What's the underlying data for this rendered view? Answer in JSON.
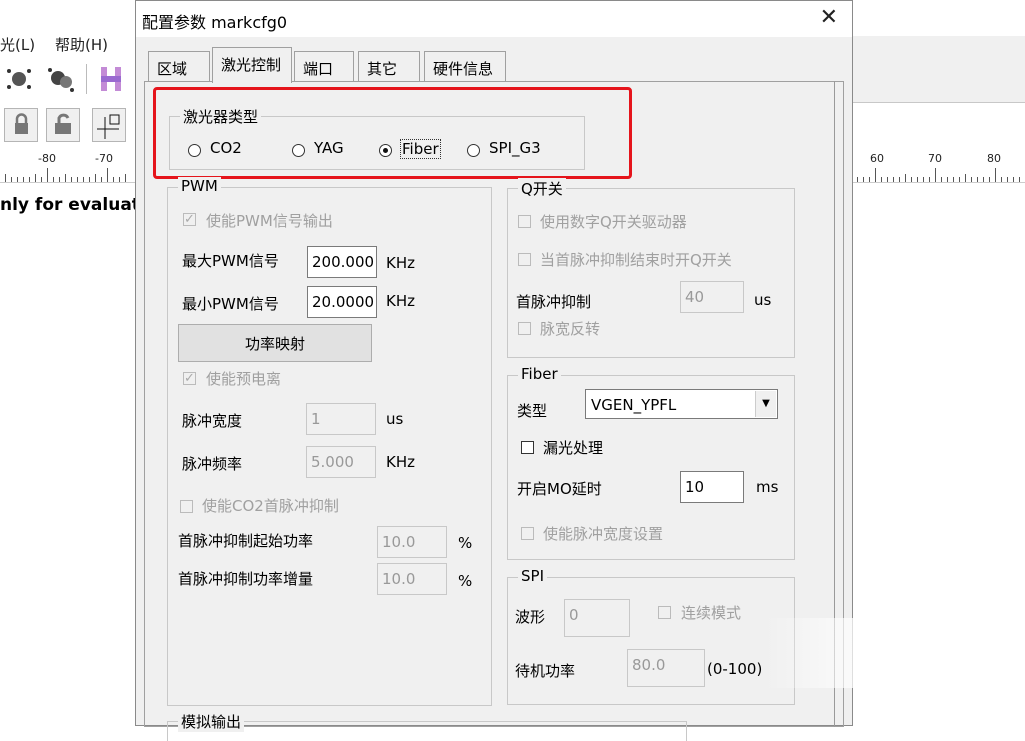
{
  "background_app": {
    "menu_items": [
      "光(L)",
      "帮助(H)"
    ],
    "ruler_left": [
      "-80",
      "-70"
    ],
    "ruler_right": [
      "60",
      "70",
      "80"
    ],
    "eval_text": "nly for evaluati"
  },
  "dialog": {
    "title": "配置参数 markcfg0",
    "tabs": [
      {
        "label": "区域"
      },
      {
        "label": "激光控制"
      },
      {
        "label": "端口"
      },
      {
        "label": "其它"
      },
      {
        "label": "硬件信息"
      }
    ],
    "laser_type": {
      "legend": "激光器类型",
      "options": [
        "CO2",
        "YAG",
        "Fiber",
        "SPI_G3"
      ],
      "selected": "Fiber",
      "highlight_color": "#e5141b"
    },
    "pwm": {
      "legend": "PWM",
      "enable_pwm_label": "使能PWM信号输出",
      "max_label": "最大PWM信号",
      "max_value": "200.000",
      "max_unit": "KHz",
      "min_label": "最小PWM信号",
      "min_value": "20.0000",
      "min_unit": "KHz",
      "power_map_button": "功率映射",
      "enable_preion_label": "使能预电离",
      "pulse_width_label": "脉冲宽度",
      "pulse_width_value": "1",
      "pulse_width_unit": "us",
      "pulse_freq_label": "脉冲频率",
      "pulse_freq_value": "5.000",
      "pulse_freq_unit": "KHz",
      "enable_co2_label": "使能CO2首脉冲抑制",
      "first_start_label": "首脉冲抑制起始功率",
      "first_start_value": "10.0",
      "first_start_unit": "%",
      "first_inc_label": "首脉冲抑制功率增量",
      "first_inc_value": "10.0",
      "first_inc_unit": "%"
    },
    "qswitch": {
      "legend": "Q开关",
      "use_digital_label": "使用数字Q开关驱动器",
      "open_after_label": "当首脉冲抑制结束时开Q开关",
      "first_pulse_label": "首脉冲抑制",
      "first_pulse_value": "40",
      "first_pulse_unit": "us",
      "pulse_invert_label": "脉宽反转"
    },
    "fiber": {
      "legend": "Fiber",
      "type_label": "类型",
      "type_value": "VGEN_YPFL",
      "leak_label": "漏光处理",
      "mo_delay_label": "开启MO延时",
      "mo_delay_value": "10",
      "mo_delay_unit": "ms",
      "enable_width_label": "使能脉冲宽度设置"
    },
    "spi": {
      "legend": "SPI",
      "waveform_label": "波形",
      "waveform_value": "0",
      "continuous_label": "连续模式",
      "standby_label": "待机功率",
      "standby_value": "80.0",
      "standby_range": "(0-100)"
    },
    "analog_legend": "模拟输出"
  }
}
